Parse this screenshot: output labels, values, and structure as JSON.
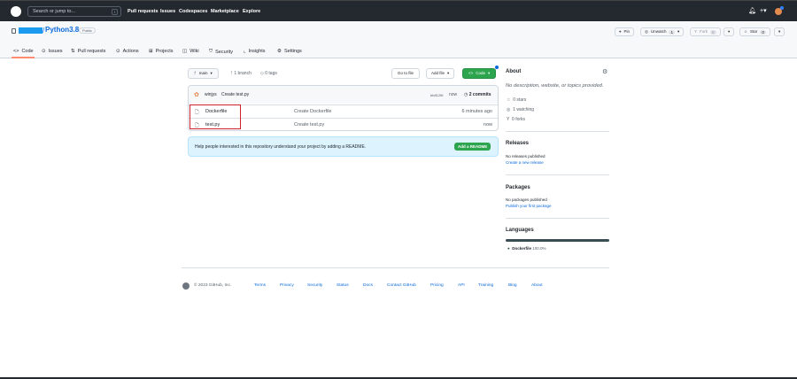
{
  "topbar": {
    "search_placeholder": "Search or jump to...",
    "slash": "/",
    "nav": [
      "Pull requests",
      "Issues",
      "Codespaces",
      "Marketplace",
      "Explore"
    ],
    "plus": "+▾"
  },
  "repo": {
    "name": "Python3.8",
    "visibility": "Public",
    "owner_separator": "/",
    "actions": {
      "pin": "Pin",
      "unwatch": "Unwatch",
      "watch_count": "1",
      "fork": "Fork",
      "fork_count": "0",
      "star": "Star",
      "star_count": "0"
    },
    "tabs": [
      "Code",
      "Issues",
      "Pull requests",
      "Actions",
      "Projects",
      "Wiki",
      "Security",
      "Insights",
      "Settings"
    ]
  },
  "toolbar": {
    "branch": "main",
    "branches": "1 branch",
    "tags": "0 tags",
    "go_to_file": "Go to file",
    "add_file": "Add file",
    "code": "Code"
  },
  "commit": {
    "author": "winjys",
    "message": "Create test.py",
    "hash": "bb812f6",
    "time": "now",
    "commits": "2 commits"
  },
  "files": [
    {
      "name": "Dockerfile",
      "message": "Create Dockerfile",
      "time": "6 minutes ago"
    },
    {
      "name": "test.py",
      "message": "Create test.py",
      "time": "now"
    }
  ],
  "readme": {
    "text": "Help people interested in this repository understand your project by adding a README.",
    "button": "Add a README"
  },
  "about": {
    "title": "About",
    "description": "No description, website, or topics provided.",
    "stars": "0 stars",
    "watching": "1 watching",
    "forks": "0 forks"
  },
  "releases": {
    "title": "Releases",
    "empty": "No releases published",
    "link": "Create a new release"
  },
  "packages": {
    "title": "Packages",
    "empty": "No packages published",
    "link": "Publish your first package"
  },
  "languages": {
    "title": "Languages",
    "items": [
      {
        "name": "Dockerfile",
        "percent": "100.0%",
        "color": "#384d54"
      }
    ]
  },
  "footer": {
    "copyright": "© 2023 GitHub, Inc.",
    "links": [
      "Terms",
      "Privacy",
      "Security",
      "Status",
      "Docs",
      "Contact GitHub",
      "Pricing",
      "API",
      "Training",
      "Blog",
      "About"
    ]
  },
  "colors": {
    "accent": "#0969da",
    "green": "#2da44e",
    "highlight": "#cf222e"
  }
}
